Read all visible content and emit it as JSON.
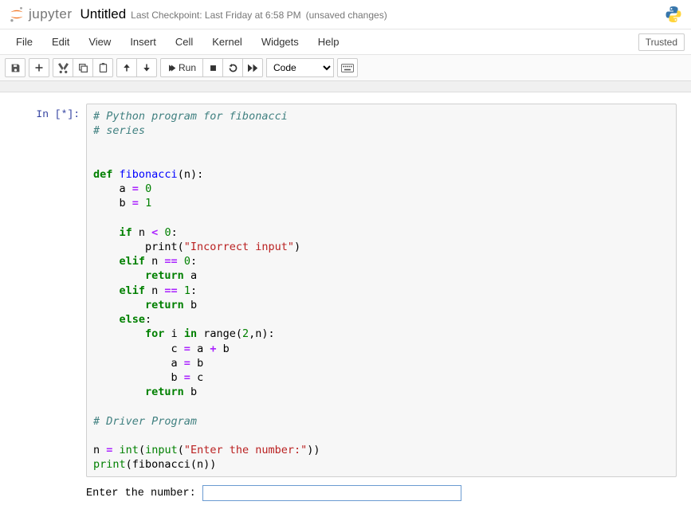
{
  "header": {
    "logo_text": "jupyter",
    "title": "Untitled",
    "checkpoint": "Last Checkpoint: Last Friday at 6:58 PM",
    "unsaved": "(unsaved changes)"
  },
  "menubar": {
    "items": [
      "File",
      "Edit",
      "View",
      "Insert",
      "Cell",
      "Kernel",
      "Widgets",
      "Help"
    ],
    "trusted": "Trusted"
  },
  "toolbar": {
    "run_label": "Run",
    "cell_type": "Code"
  },
  "cell": {
    "prompt": "In [*]:",
    "code": {
      "c_line1": "# Python program for fibonacci",
      "c_line2": "# series",
      "kw_def": "def",
      "fn_name": "fibonacci",
      "paren_n": "(n):",
      "a_eq": "    a ",
      "op_eq": "=",
      "sp": " ",
      "zero": "0",
      "b_eq": "    b ",
      "one": "1",
      "kw_if": "if",
      "cond_nlt0": " n ",
      "op_lt": "<",
      "colon": ":",
      "print_open": "        print(",
      "str_incorrect": "\"Incorrect input\"",
      "close_paren": ")",
      "kw_elif": "elif",
      "cond_neq": " n ",
      "op_eqeq": "==",
      "kw_return": "return",
      "ret_a": " a",
      "ret_b": " b",
      "kw_else": "else",
      "kw_for": "for",
      "for_body": " i ",
      "kw_in": "in",
      "range_call": " range(",
      "two": "2",
      "comma_n": ",n):",
      "c_assign": "            c ",
      "op_plus": "+",
      "a_assign": "            a ",
      "b_assign": "            b ",
      "var_a": " a",
      "var_b": " b",
      "var_c": " c",
      "ab": " a ",
      "ret_b2": " b",
      "c_driver": "# Driver Program",
      "n_eq": "n ",
      "int_call": "int",
      "input_call": "input",
      "str_enter": "\"Enter the number:\"",
      "print2": "print",
      "fib_call": "(fibonacci(n))"
    },
    "output_prompt_text": "Enter the number: ",
    "stdin_value": ""
  }
}
